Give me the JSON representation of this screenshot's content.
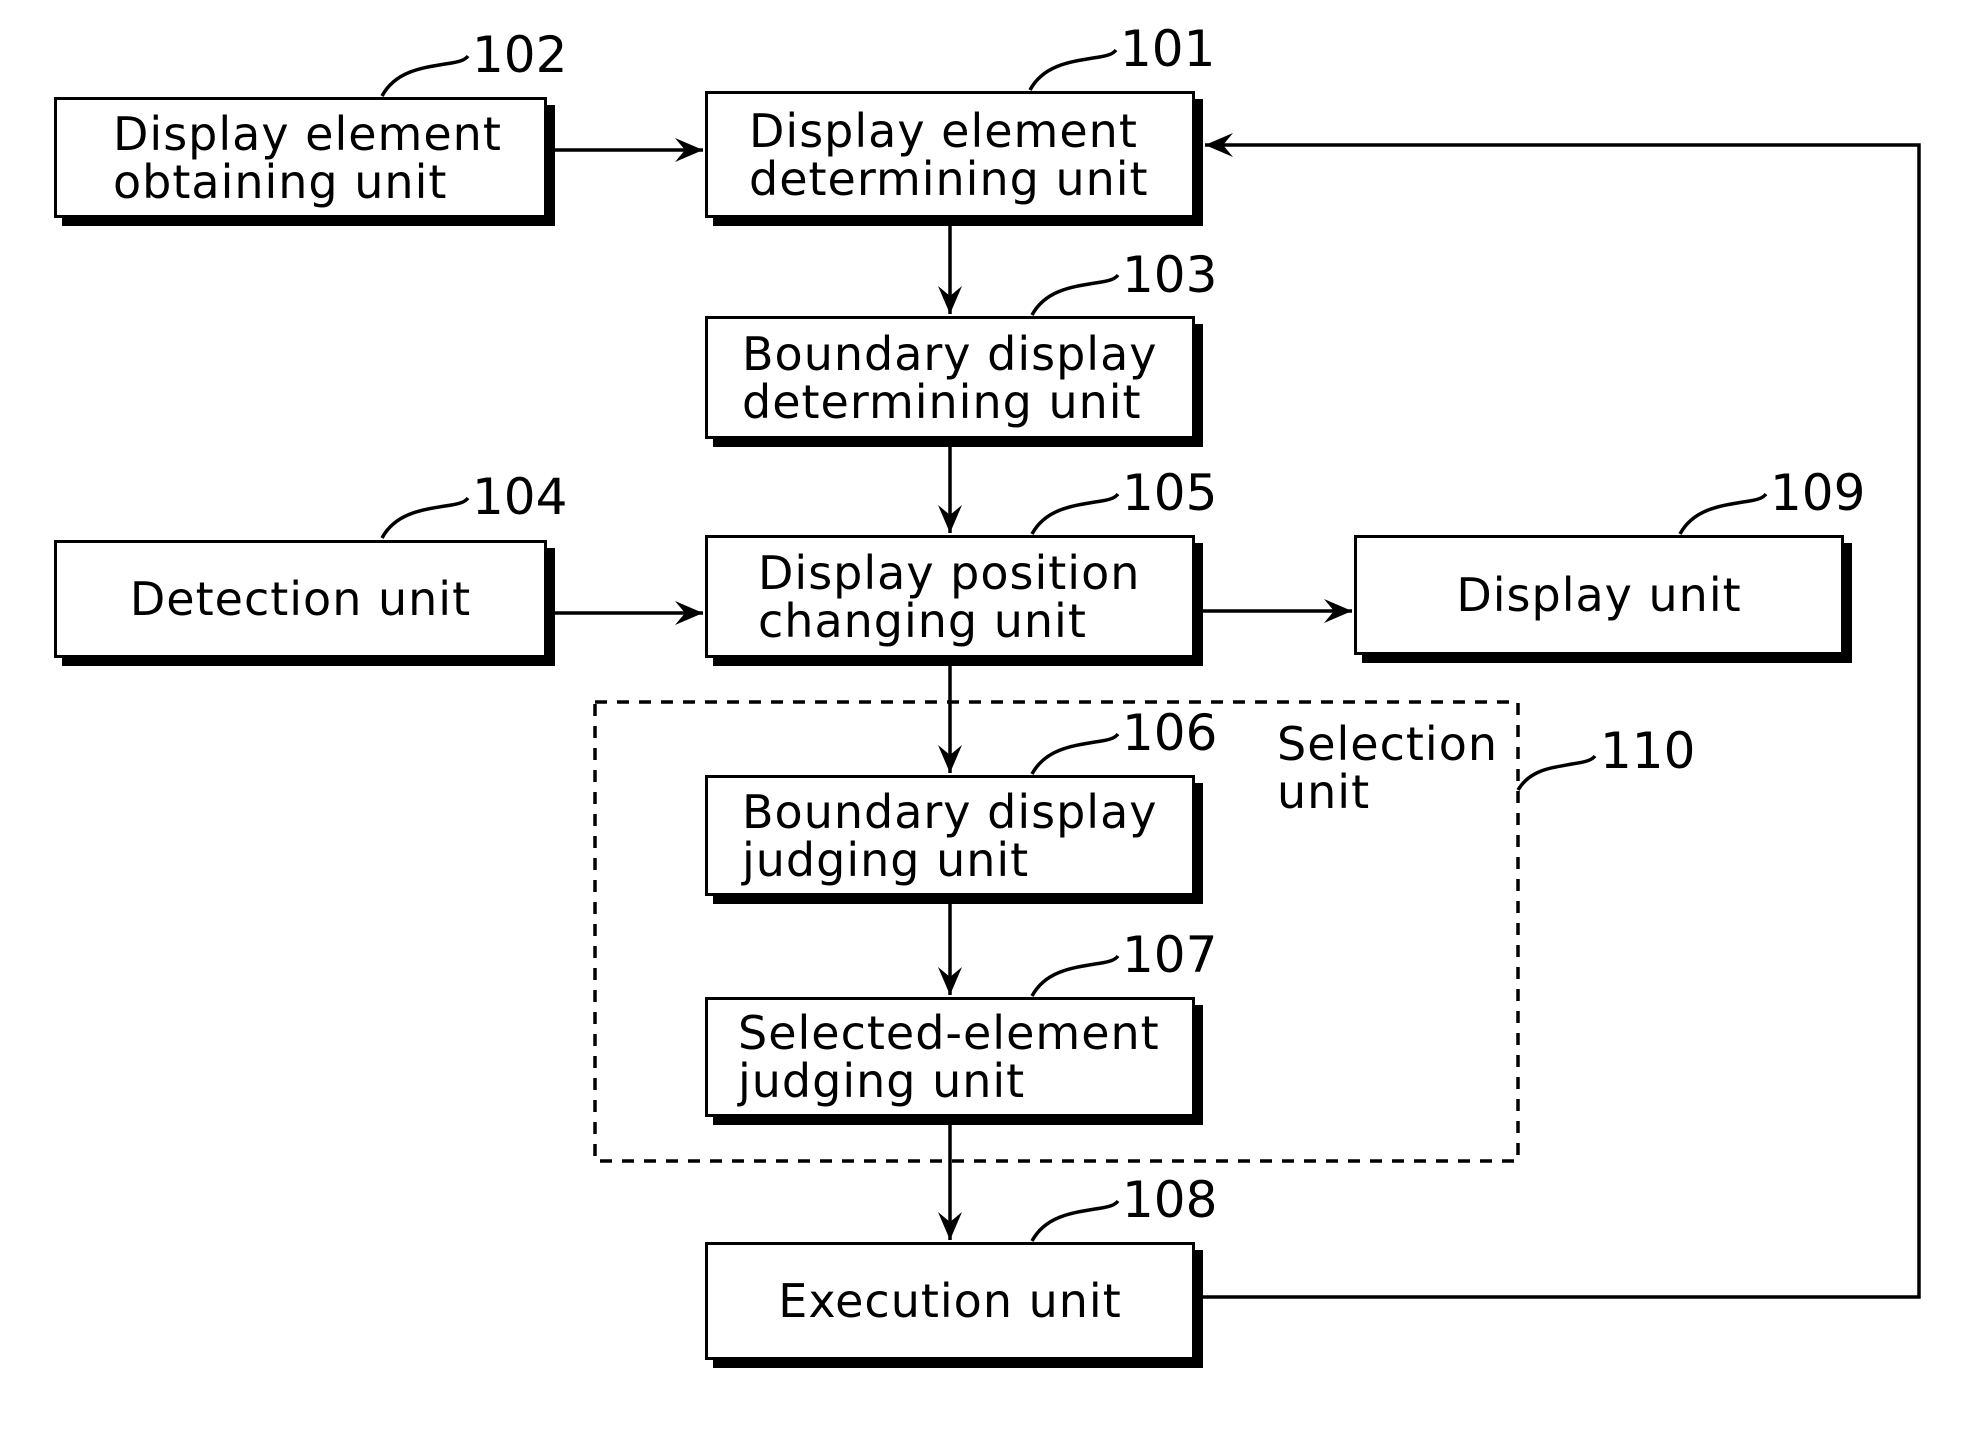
{
  "diagram": {
    "blocks": {
      "b102": {
        "ref": "102",
        "line1": "Display element",
        "line2": "obtaining unit"
      },
      "b101": {
        "ref": "101",
        "line1": "Display element",
        "line2": "determining unit"
      },
      "b103": {
        "ref": "103",
        "line1": "Boundary display",
        "line2": "determining unit"
      },
      "b104": {
        "ref": "104",
        "line1": "Detection unit"
      },
      "b105": {
        "ref": "105",
        "line1": "Display position",
        "line2": "changing unit"
      },
      "b109": {
        "ref": "109",
        "line1": "Display unit"
      },
      "b106": {
        "ref": "106",
        "line1": "Boundary display",
        "line2": "judging unit"
      },
      "b107": {
        "ref": "107",
        "line1": "Selected-element",
        "line2": "judging unit"
      },
      "b108": {
        "ref": "108",
        "line1": "Execution unit"
      }
    },
    "group": {
      "ref": "110",
      "line1": "Selection",
      "line2": "unit"
    },
    "connections": [
      {
        "from": "102",
        "to": "101"
      },
      {
        "from": "101",
        "to": "103"
      },
      {
        "from": "103",
        "to": "105"
      },
      {
        "from": "104",
        "to": "105"
      },
      {
        "from": "105",
        "to": "109"
      },
      {
        "from": "105",
        "to": "106"
      },
      {
        "from": "106",
        "to": "107"
      },
      {
        "from": "107",
        "to": "108"
      },
      {
        "from": "108",
        "to": "101"
      }
    ]
  }
}
